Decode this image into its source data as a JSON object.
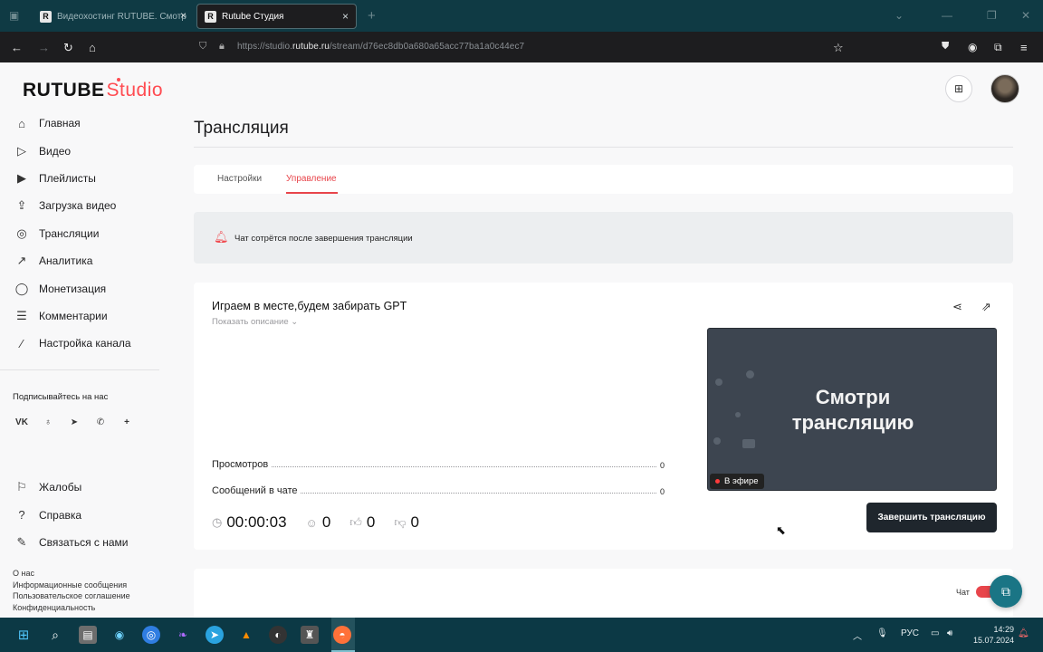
{
  "browser": {
    "tabs": [
      {
        "label": "Видеохостинг RUTUBE. Смотр",
        "active": false
      },
      {
        "label": "Rutube Студия",
        "active": true
      }
    ],
    "url_prefix": "https://studio.",
    "url_domain": "rutube.ru",
    "url_path": "/stream/d76ec8db0a680a65acc77ba1a0c44ec7"
  },
  "header": {
    "logo_main": "RUTUBE",
    "logo_sub": "Studio"
  },
  "sidebar": {
    "items": [
      {
        "label": "Главная",
        "icon": "home-icon"
      },
      {
        "label": "Видео",
        "icon": "video-icon"
      },
      {
        "label": "Плейлисты",
        "icon": "playlist-icon"
      },
      {
        "label": "Загрузка видео",
        "icon": "upload-icon"
      },
      {
        "label": "Трансляции",
        "icon": "broadcast-icon"
      },
      {
        "label": "Аналитика",
        "icon": "analytics-icon"
      },
      {
        "label": "Монетизация",
        "icon": "coin-icon"
      },
      {
        "label": "Комментарии",
        "icon": "comments-icon"
      },
      {
        "label": "Настройка канала",
        "icon": "wand-icon"
      }
    ],
    "follow_title": "Подписывайтесь на нас",
    "bottom_items": [
      {
        "label": "Жалобы",
        "icon": "flag-icon"
      },
      {
        "label": "Справка",
        "icon": "help-icon"
      },
      {
        "label": "Связаться с нами",
        "icon": "contact-icon"
      }
    ],
    "footer_links": [
      "О нас",
      "Информационные сообщения",
      "Пользовательское соглашение",
      "Конфиденциальность"
    ]
  },
  "main": {
    "title": "Трансляция",
    "tabs": [
      {
        "label": "Настройки",
        "active": false
      },
      {
        "label": "Управление",
        "active": true
      }
    ],
    "notice": "Чат сотрётся после завершения трансляции",
    "stream": {
      "title": "Играем в месте,будем забирать GPT",
      "show_description": "Показать описание",
      "stats": [
        {
          "label": "Просмотров",
          "value": "0"
        },
        {
          "label": "Сообщений в чате",
          "value": "0"
        }
      ],
      "duration": "00:00:03",
      "viewers": "0",
      "likes": "0",
      "dislikes": "0",
      "preview_text_line1": "Смотри",
      "preview_text_line2": "трансляцию",
      "live_badge": "В эфире",
      "end_button": "Завершить трансляцию"
    },
    "chat_label": "Чат",
    "chat_enabled": true
  },
  "taskbar": {
    "lang": "РУС",
    "time": "14:29",
    "date": "15.07.2024"
  },
  "colors": {
    "accent": "#e8454b",
    "brand_red": "#ff4b51",
    "tabbar": "#0f3a44",
    "end_button": "#1f262d"
  }
}
